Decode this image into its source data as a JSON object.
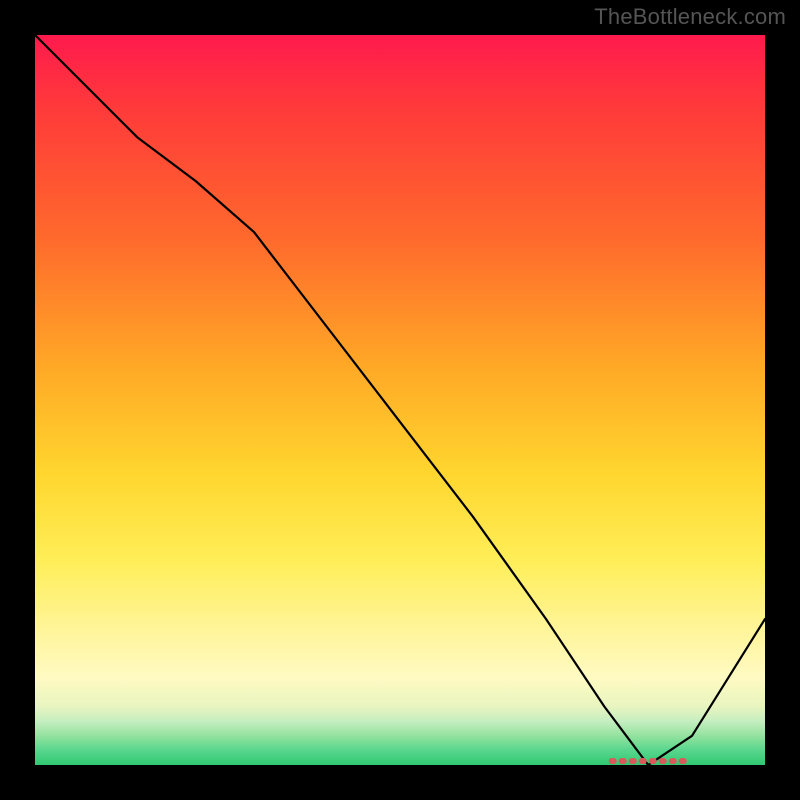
{
  "watermark": "TheBottleneck.com",
  "chart_data": {
    "type": "line",
    "title": "",
    "xlabel": "",
    "ylabel": "",
    "xlim": [
      0,
      100
    ],
    "ylim": [
      0,
      100
    ],
    "grid": false,
    "legend": false,
    "annotations": [
      {
        "name": "optimal-range",
        "type": "segment",
        "x_start": 79,
        "x_end": 89,
        "y": 0,
        "color": "#d85a5a"
      }
    ],
    "series": [
      {
        "name": "bottleneck-curve",
        "color": "#000000",
        "x": [
          0,
          5,
          14,
          22,
          30,
          40,
          50,
          60,
          70,
          78,
          84,
          90,
          95,
          100
        ],
        "y": [
          100,
          95,
          86,
          80,
          73,
          60,
          47,
          34,
          20,
          8,
          0,
          4,
          12,
          20
        ]
      }
    ],
    "gradient": {
      "top_color": "#ff1a4d",
      "mid_color": "#ffd62e",
      "bottom_color": "#30c972"
    }
  }
}
